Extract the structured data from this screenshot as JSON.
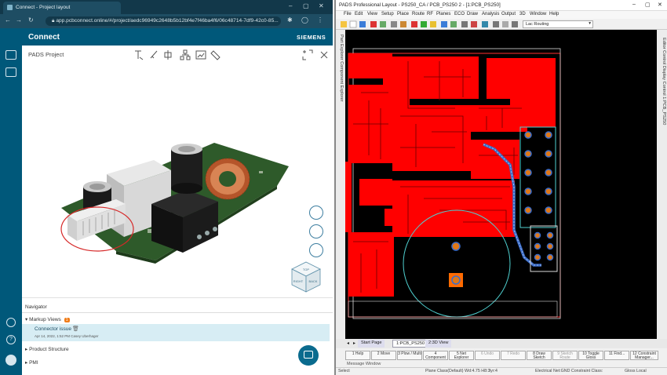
{
  "browser": {
    "tab_title": "Connect - Project layout",
    "url": "app.pcbconnect.online/#/project/aedc96949c2648b5b12bf4e7f46ba4f6/06c48714-7df9-42c0-85..."
  },
  "app": {
    "brand": "Connect",
    "company": "SIEMENS",
    "panel_title": "PADS Project"
  },
  "viewcube": {
    "top": "TOP",
    "right": "RIGHT",
    "back": "BACK"
  },
  "navigator": {
    "title": "Navigator",
    "markup_views": {
      "label": "Markup Views",
      "count": "1"
    },
    "connector_issue": {
      "title": "Connector issue",
      "meta": "Apr 14, 2022, 1:52 PM Casey Uberhager"
    },
    "product_structure": "Product Structure",
    "pmi": "PMI"
  },
  "pads": {
    "title": "PADS Professional Layout - PS250_CA / PCB_PS250 2 - [1:PCB_PS250]",
    "menu": [
      "File",
      "Edit",
      "View",
      "Setup",
      "Place",
      "Route",
      "RF",
      "Planes",
      "ECO",
      "Draw",
      "Analysis",
      "Output",
      "3D",
      "Window",
      "Help"
    ],
    "routing_mode": "Lac Routing",
    "left_vtab": "Part Explorer  Component Explorer",
    "right_vtab": "Editor Control  Display Control  1:PCB_PS250",
    "tabs": [
      "Start Page",
      "1:PCB_PS250",
      "2:3D View"
    ],
    "fkeys": [
      "1 Help",
      "2 Move",
      "3 Plow / Multi",
      "4 Component Explorer",
      "5 Net Explorer",
      "6 Undo",
      "7 Redo",
      "8 Draw Sketch",
      "9 Sketch Route",
      "10 Toggle Gloss",
      "11 Find...",
      "12 Constraint Manager..."
    ],
    "message_window": "Message Window",
    "status": {
      "left": "Select",
      "mid1": "Plane Class(Default) Wd:4.75 H8:3",
      "mid2": "lyr:4",
      "mid3": "Electrical Net:GND Constraint Class:",
      "right": "Gloss Local"
    }
  },
  "colors": {
    "teal_brand": "#00587a",
    "pcb_red": "#ff0000",
    "pad_orange": "#e07818",
    "trace_blue": "#3b6cc8",
    "badge_orange": "#f07d1a"
  }
}
